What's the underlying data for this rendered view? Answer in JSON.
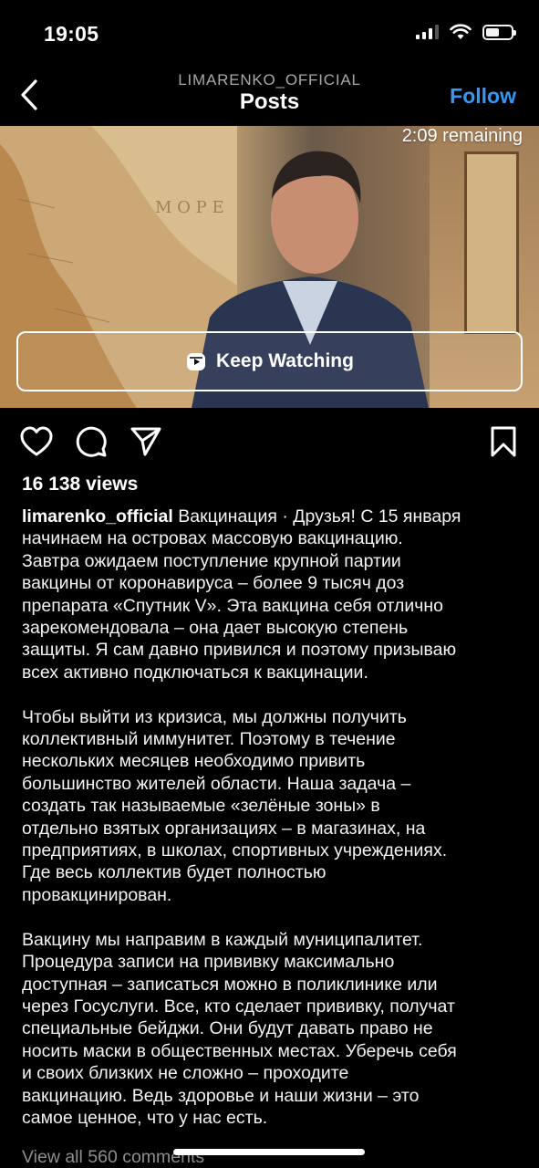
{
  "status_bar": {
    "time": "19:05"
  },
  "header": {
    "account": "LIMARENKO_OFFICIAL",
    "title": "Posts",
    "follow_label": "Follow"
  },
  "video": {
    "remaining": "2:09 remaining",
    "keep_watching_label": "Keep Watching"
  },
  "post": {
    "views": "16 138 views",
    "username": "limarenko_official",
    "caption_first_line_rest": "Вакцинация · Друзья! С 15 января",
    "paragraph1": [
      "начинаем на островах массовую вакцинацию.",
      "Завтра ожидаем поступление крупной партии",
      "вакцины от коронавируса – более 9 тысяч доз",
      "препарата «Спутник V». Эта вакцина себя отлично",
      "зарекомендовала – она дает высокую степень",
      "защиты. Я сам давно привился и поэтому призываю",
      "всех активно подключаться к вакцинации."
    ],
    "paragraph2": [
      "Чтобы выйти из кризиса, мы должны получить",
      "коллективный иммунитет. Поэтому в течение",
      "нескольких месяцев необходимо привить",
      "большинство жителей области. Наша задача –",
      "создать так называемые «зелёные зоны» в",
      "отдельно взятых организациях – в магазинах, на",
      "предприятиях, в школах, спортивных учреждениях.",
      "Где весь коллектив будет полностью",
      "провакцинирован."
    ],
    "paragraph3": [
      "Вакцину мы направим в каждый муниципалитет.",
      "Процедура записи на прививку максимально",
      "доступная – записаться можно в поликлинике или",
      "через Госуслуги. Все, кто сделает прививку, получат",
      "специальные бейджи. Они будут давать право не",
      "носить маски в общественных местах. Уберечь себя",
      "и своих близких не сложно – проходите",
      "вакцинацию. Ведь здоровье и наши жизни – это",
      "самое ценное, что у нас есть."
    ],
    "view_comments": "View all 560 comments"
  },
  "colors": {
    "accent": "#3797f0",
    "background": "#000000",
    "muted": "#8e8e8e"
  }
}
